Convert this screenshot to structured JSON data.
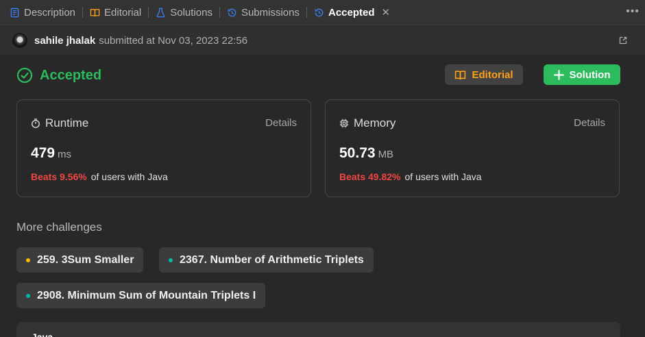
{
  "tabs": [
    {
      "label": "Description",
      "icon": "description-icon",
      "color": "#3b82f6"
    },
    {
      "label": "Editorial",
      "icon": "book-icon",
      "color": "#ffa116"
    },
    {
      "label": "Solutions",
      "icon": "flask-icon",
      "color": "#3b82f6"
    },
    {
      "label": "Submissions",
      "icon": "history-icon",
      "color": "#3b82f6"
    },
    {
      "label": "Accepted",
      "icon": "history-icon",
      "color": "#3b82f6",
      "active": true
    }
  ],
  "submission": {
    "username": "sahile jhalak",
    "submitted_text": "submitted at Nov 03, 2023 22:56"
  },
  "status": {
    "label": "Accepted",
    "color": "#2cbb5d"
  },
  "buttons": {
    "editorial": "Editorial",
    "solution": "Solution"
  },
  "runtime": {
    "title": "Runtime",
    "details": "Details",
    "value": "479",
    "unit": "ms",
    "beats": "Beats 9.56%",
    "beats_suffix": "of users with Java"
  },
  "memory": {
    "title": "Memory",
    "details": "Details",
    "value": "50.73",
    "unit": "MB",
    "beats": "Beats 49.82%",
    "beats_suffix": "of users with Java"
  },
  "more_challenges": {
    "title": "More challenges",
    "items": [
      {
        "label": "259. 3Sum Smaller",
        "difficulty_color": "#ffb800"
      },
      {
        "label": "2367. Number of Arithmetic Triplets",
        "difficulty_color": "#00b8a3"
      },
      {
        "label": "2908. Minimum Sum of Mountain Triplets I",
        "difficulty_color": "#00b8a3"
      }
    ]
  },
  "code": {
    "language": "Java"
  },
  "colors": {
    "accent_green": "#2cbb5d",
    "accent_orange": "#ffa116",
    "beats_red": "#ef4743",
    "background": "#282828"
  }
}
